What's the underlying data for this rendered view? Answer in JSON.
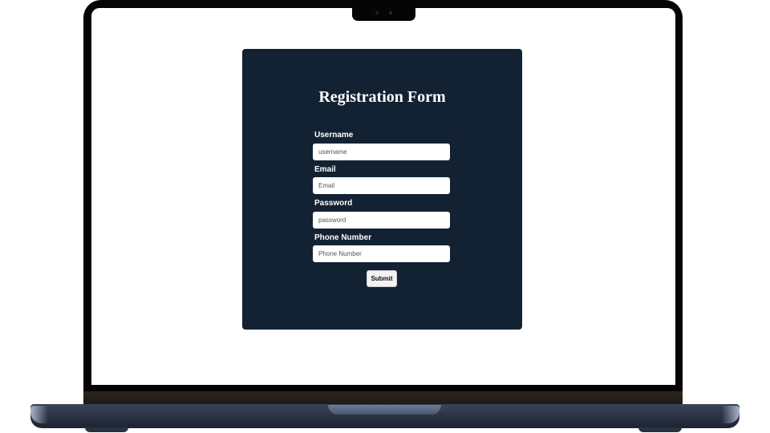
{
  "form": {
    "title": "Registration Form",
    "fields": [
      {
        "label": "Username",
        "placeholder": "username",
        "value": ""
      },
      {
        "label": "Email",
        "placeholder": "Email",
        "value": ""
      },
      {
        "label": "Password",
        "placeholder": "password",
        "value": ""
      },
      {
        "label": "Phone Number",
        "placeholder": "Phone Number",
        "value": ""
      }
    ],
    "submit_label": "Submit"
  },
  "colors": {
    "card_background": "#132233",
    "label_text": "#ffffff",
    "input_background": "#ffffff",
    "button_background": "#f3f3f3"
  }
}
